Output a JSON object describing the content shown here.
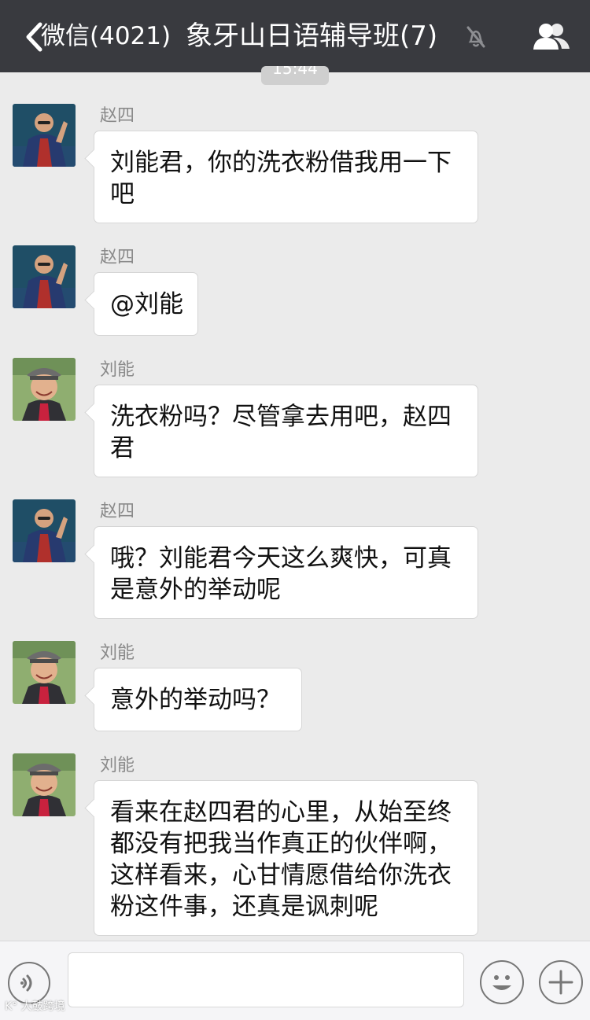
{
  "header": {
    "back_label": "微信(4021)",
    "title": "象牙山日语辅导班(7)",
    "icons": [
      "chevron-left-icon",
      "muted-bell-icon",
      "group-members-icon"
    ],
    "colors": {
      "bar": "#393a3f",
      "text": "#ffffff"
    }
  },
  "time_pill": "15:44",
  "messages": [
    {
      "sender": "赵四",
      "avatar": "zhao-si-avatar",
      "text_lines": [
        "刘能君，你的洗衣粉借我用一下",
        "吧"
      ]
    },
    {
      "sender": "赵四",
      "avatar": "zhao-si-avatar",
      "text_lines": [
        "@刘能"
      ]
    },
    {
      "sender": "刘能",
      "avatar": "liu-neng-avatar",
      "text_lines": [
        "洗衣粉吗？尽管拿去用吧，赵四",
        "君"
      ]
    },
    {
      "sender": "赵四",
      "avatar": "zhao-si-avatar",
      "text_lines": [
        "哦？刘能君今天这么爽快，可真",
        "是意外的举动呢"
      ]
    },
    {
      "sender": "刘能",
      "avatar": "liu-neng-avatar",
      "text_lines": [
        "意外的举动吗？"
      ]
    },
    {
      "sender": "刘能",
      "avatar": "liu-neng-avatar",
      "text_lines": [
        "看来在赵四君的心里，从始至终",
        "都没有把我当作真正的伙伴啊，",
        "这样看来，心甘情愿借给你洗衣",
        "粉这件事，还真是讽刺呢"
      ]
    }
  ],
  "composer": {
    "icons": [
      "voice-icon",
      "emoji-icon",
      "plus-icon"
    ],
    "input_value": ""
  },
  "watermark": "K° 大鼓跨境"
}
